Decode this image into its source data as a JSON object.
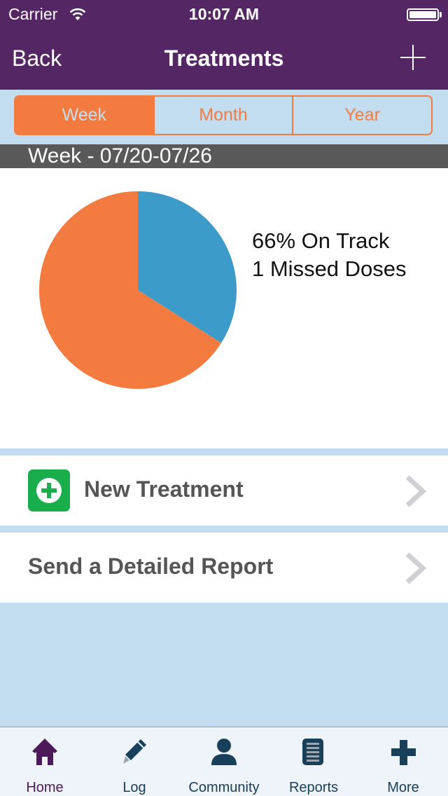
{
  "status_bar": {
    "carrier": "Carrier",
    "time": "10:07 AM",
    "wifi_icon": "wifi-icon",
    "battery_icon": "battery-full-icon"
  },
  "nav": {
    "back_label": "Back",
    "title": "Treatments",
    "add_icon": "plus-icon"
  },
  "segments": [
    {
      "label": "Week",
      "active": true
    },
    {
      "label": "Month",
      "active": false
    },
    {
      "label": "Year",
      "active": false
    }
  ],
  "week_header": "Week - 07/20-07/26",
  "summary": {
    "on_track": "66% On Track",
    "missed": "1 Missed Doses"
  },
  "chart_data": {
    "type": "pie",
    "title": "",
    "slices": [
      {
        "label": "Missed",
        "value": 34,
        "color": "#3d9bc9"
      },
      {
        "label": "On Track",
        "value": 66,
        "color": "#f37b40"
      }
    ],
    "start_angle": "12 o'clock, clockwise",
    "legend": "none"
  },
  "rows": [
    {
      "label": "New Treatment",
      "icon": "add-circle-icon",
      "chevron": "chevron-right-icon"
    },
    {
      "label": "Send a Detailed Report",
      "chevron": "chevron-right-icon"
    }
  ],
  "tabs": [
    {
      "label": "Home",
      "icon": "home-icon",
      "active": true
    },
    {
      "label": "Log",
      "icon": "pencil-icon",
      "active": false
    },
    {
      "label": "Community",
      "icon": "person-icon",
      "active": false
    },
    {
      "label": "Reports",
      "icon": "report-icon",
      "active": false
    },
    {
      "label": "More",
      "icon": "plus-icon",
      "active": false
    }
  ],
  "colors": {
    "nav_purple": "#542664",
    "accent_orange": "#f37b40",
    "pie_blue": "#3d9bc9",
    "background_blue": "#c1ddef",
    "green": "#1aad4b",
    "tab_icon": "#18405a",
    "tab_active": "#4c1a5a"
  }
}
